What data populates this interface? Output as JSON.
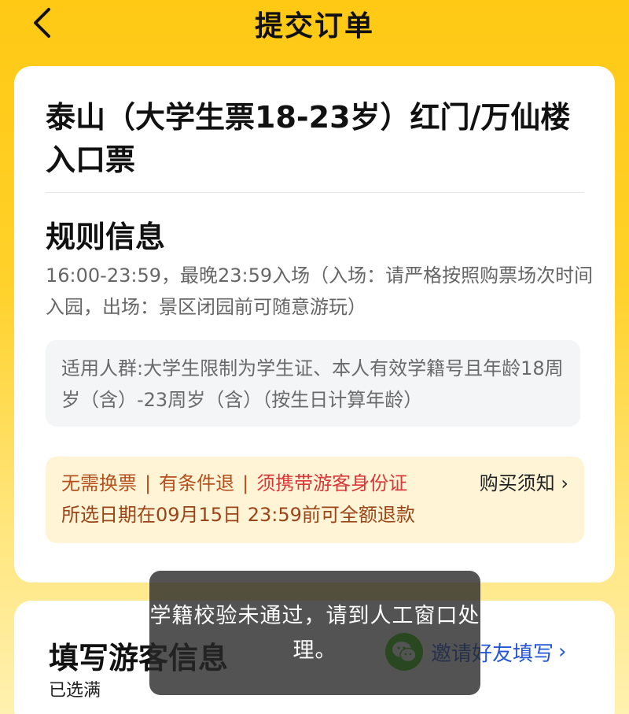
{
  "header": {
    "title": "提交订单",
    "back_icon": "chevron-left-icon"
  },
  "product": {
    "title": "泰山（大学生票18-23岁）红门/万仙楼入口票"
  },
  "rules": {
    "section_title": "规则信息",
    "time_rule": "16:00-23:59，最晚23:59入场（入场：请严格按照购票场次时间入园，出场：景区闭园前可随意游玩）",
    "audience": "适用人群:大学生限制为学生证、本人有效学籍号且年龄18周岁（含）-23周岁（含）（按生日计算年龄）"
  },
  "notice": {
    "tag_no_exchange": "无需换票",
    "tag_refund": "有条件退",
    "tag_id": "须携带游客身份证",
    "separator": "|",
    "buy_notice": "购买须知 ›",
    "refund_text": "所选日期在09月15日 23:59前可全额退款"
  },
  "traveler": {
    "title": "填写游客信息",
    "selected": "已选满",
    "invite_label": "邀请好友填写",
    "invite_arrow": "›",
    "invite_icon": "wechat-icon"
  },
  "toast": {
    "message": "学籍校验未通过，请到人工窗口处理。"
  },
  "colors": {
    "header_bg": "#FFC914",
    "notice_bg": "#FFF5D6",
    "id_requirement": "#D9383A",
    "link_blue": "#2456D6",
    "wechat_green": "#2DC100"
  }
}
